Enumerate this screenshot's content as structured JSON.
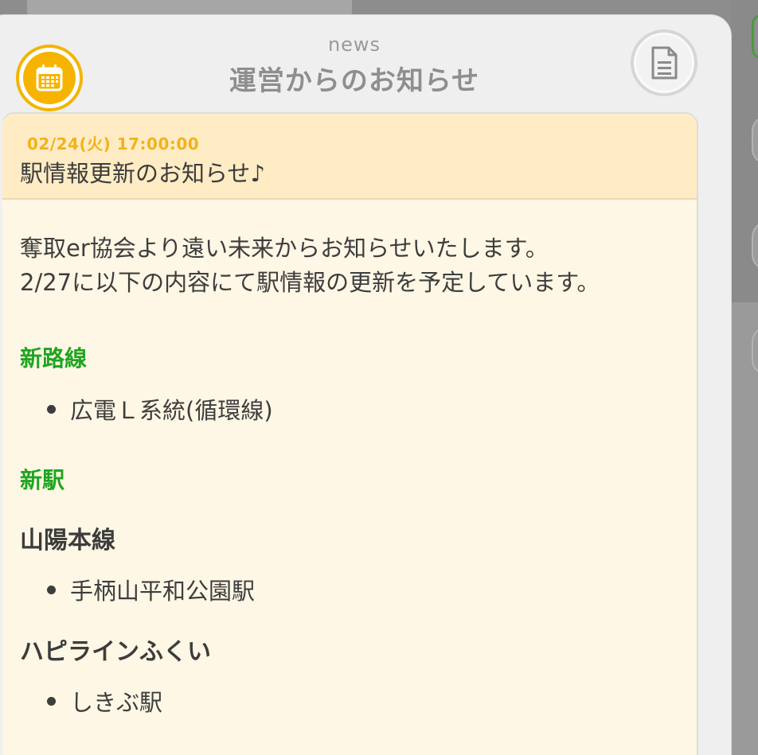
{
  "header": {
    "eyebrow": "news",
    "title": "運営からのお知らせ",
    "calendar_icon": "calendar-icon",
    "document_icon": "document-icon",
    "accent_color": "#f4b400"
  },
  "news": {
    "date": "02/24(火) 17:00:00",
    "headline": "駅情報更新のお知らせ♪",
    "intro_lines": [
      "奪取er協会より遠い未来からお知らせいたします。",
      "2/27に以下の内容にて駅情報の更新を予定しています。"
    ],
    "sections": {
      "new_lines_heading": "新路線",
      "new_lines_items": [
        "広電Ｌ系統(循環線)"
      ],
      "new_stations_heading": "新駅",
      "groups": [
        {
          "name": "山陽本線",
          "items": [
            "手柄山平和公園駅"
          ]
        },
        {
          "name": "ハピラインふくい",
          "items": [
            "しきぶ駅"
          ]
        }
      ]
    },
    "heading_color": "#1fa51f",
    "date_color": "#f3b21a"
  }
}
